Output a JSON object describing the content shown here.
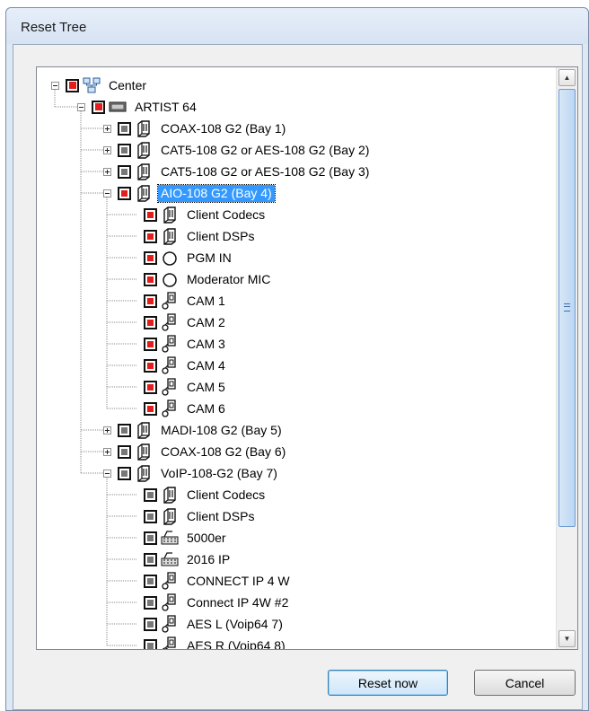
{
  "window": {
    "title": "Reset Tree"
  },
  "buttons": {
    "reset_label": "Reset now",
    "cancel_label": "Cancel"
  },
  "tree": [
    {
      "label": "Center",
      "icon": "network-icon",
      "check": "partial",
      "expander": "minus"
    },
    {
      "label": "ARTIST 64",
      "icon": "rack-device-icon",
      "check": "partial",
      "expander": "minus"
    },
    {
      "label": "COAX-108 G2 (Bay 1)",
      "icon": "card-icon",
      "check": "off",
      "expander": "plus"
    },
    {
      "label": "CAT5-108 G2 or AES-108 G2 (Bay 2)",
      "icon": "card-icon",
      "check": "off",
      "expander": "plus"
    },
    {
      "label": "CAT5-108 G2 or AES-108 G2 (Bay 3)",
      "icon": "card-icon",
      "check": "off",
      "expander": "plus"
    },
    {
      "label": "AIO-108 G2 (Bay 4)",
      "icon": "card-icon",
      "check": "on",
      "expander": "minus",
      "selected": true
    },
    {
      "label": "Client Codecs",
      "icon": "card-icon",
      "check": "on"
    },
    {
      "label": "Client DSPs",
      "icon": "card-icon",
      "check": "on"
    },
    {
      "label": "PGM IN",
      "icon": "circle-port-icon",
      "check": "on"
    },
    {
      "label": "Moderator MIC",
      "icon": "circle-port-icon",
      "check": "on"
    },
    {
      "label": "CAM 1",
      "icon": "connector-icon",
      "check": "on"
    },
    {
      "label": "CAM 2",
      "icon": "connector-icon",
      "check": "on"
    },
    {
      "label": "CAM 3",
      "icon": "connector-icon",
      "check": "on"
    },
    {
      "label": "CAM 4",
      "icon": "connector-icon",
      "check": "on"
    },
    {
      "label": "CAM 5",
      "icon": "connector-icon",
      "check": "on"
    },
    {
      "label": "CAM 6",
      "icon": "connector-icon",
      "check": "on"
    },
    {
      "label": "MADI-108 G2 (Bay 5)",
      "icon": "card-icon",
      "check": "off",
      "expander": "plus"
    },
    {
      "label": "COAX-108 G2 (Bay 6)",
      "icon": "card-icon",
      "check": "off",
      "expander": "plus"
    },
    {
      "label": "VoIP-108-G2 (Bay 7)",
      "icon": "card-icon",
      "check": "off",
      "expander": "minus"
    },
    {
      "label": "Client Codecs",
      "icon": "card-icon",
      "check": "off"
    },
    {
      "label": "Client DSPs",
      "icon": "card-icon",
      "check": "off"
    },
    {
      "label": "5000er",
      "icon": "phone-icon",
      "check": "off"
    },
    {
      "label": "2016 IP",
      "icon": "phone-icon",
      "check": "off"
    },
    {
      "label": "CONNECT IP 4 W",
      "icon": "connector-icon",
      "check": "off"
    },
    {
      "label": "Connect IP 4W #2",
      "icon": "connector-icon",
      "check": "off"
    },
    {
      "label": "AES  L (Voip64 7)",
      "icon": "connector-icon",
      "check": "off"
    },
    {
      "label": "AES R (Voip64 8)",
      "icon": "connector-icon",
      "check": "off"
    }
  ],
  "colors": {
    "checked": "#e31c1c",
    "selection": "#3399ff"
  }
}
